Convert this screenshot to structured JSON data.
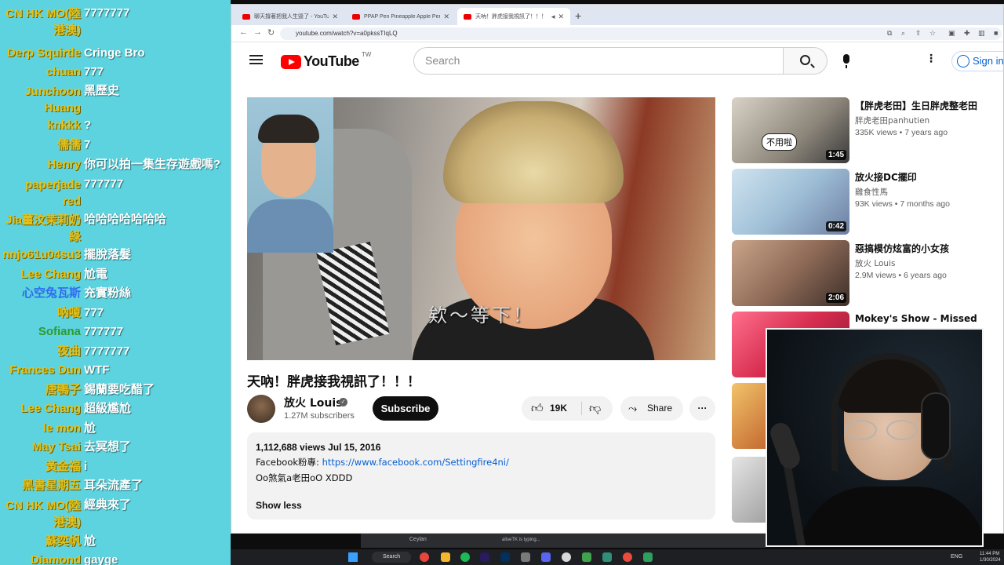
{
  "chat": [
    {
      "user": "CN HK MO(陸港澳)",
      "user_line2": "港澳)",
      "msg": "7777777",
      "style": "gold"
    },
    {
      "user": "Derp Squirtle",
      "msg": "Cringe Bro",
      "style": "gold"
    },
    {
      "user": "chuan",
      "msg": "777",
      "style": "gold"
    },
    {
      "user": "Junchoon Huang",
      "user_line2": "Huang",
      "msg": "黑歷史",
      "style": "gold"
    },
    {
      "user": "knkkk",
      "msg": "?",
      "style": "gold"
    },
    {
      "user": "儒儒",
      "msg": "7",
      "style": "gold"
    },
    {
      "user": "Henry",
      "msg": "你可以拍一集生存遊戲嗎?",
      "style": "gold"
    },
    {
      "user": "paperjade red",
      "user_line2": "red",
      "msg": "777777",
      "style": "gold"
    },
    {
      "user": "Jia薑汶茉莉奶綠",
      "user_line2": "綠",
      "msg": "哈哈哈哈哈哈哈",
      "style": "gold"
    },
    {
      "user": "nnjo61u04su3",
      "msg": "擺脫落髮",
      "style": "gold"
    },
    {
      "user": "Lee Chang",
      "msg": "尬電",
      "style": "gold"
    },
    {
      "user": "心空兔瓦斯",
      "msg": "充實粉絲",
      "style": "blue"
    },
    {
      "user": "吶嗄",
      "msg": "777",
      "style": "gold"
    },
    {
      "user": "Sofiana",
      "msg": "777777",
      "style": "green"
    },
    {
      "user": "夜曲",
      "msg": "7777777",
      "style": "gold"
    },
    {
      "user": "Frances Dun",
      "msg": "WTF",
      "style": "gold"
    },
    {
      "user": "唐鴨子",
      "msg": "錫蘭要吃醋了",
      "style": "gold"
    },
    {
      "user": "Lee Chang",
      "msg": "超級尷尬",
      "style": "gold"
    },
    {
      "user": "le mon",
      "msg": "尬",
      "style": "gold"
    },
    {
      "user": "May Tsai",
      "msg": "去冥想了",
      "style": "gold"
    },
    {
      "user": "黃金福",
      "msg": "i",
      "style": "gold"
    },
    {
      "user": "黑書星期五",
      "msg": "耳朵流產了",
      "style": "gold"
    },
    {
      "user": "CN HK MO(陸港澳)",
      "user_line2": "港澳)",
      "msg": "經典來了",
      "style": "gold"
    },
    {
      "user": "蘇奕帆",
      "msg": "尬",
      "style": "gold"
    },
    {
      "user": "Diamond",
      "msg": "gayge",
      "style": "gold"
    }
  ],
  "browser": {
    "tabs": [
      {
        "label": "聊天撐著把我人生毀了 - YouTube"
      },
      {
        "label": "PPAP Pen Pineapple Apple Pen"
      },
      {
        "label": "天吶！胖虎接我視訊了！！！"
      }
    ],
    "url": "youtube.com/watch?v=a0pkssTIqLQ"
  },
  "youtube": {
    "logo_text": "YouTube",
    "region": "TW",
    "search_placeholder": "Search",
    "signin": "Sign in",
    "video": {
      "subtitle": "欸～等下！",
      "title": "天吶！胖虎接我視訊了！！！",
      "channel": "放火 Louis",
      "subs": "1.27M subscribers",
      "subscribe": "Subscribe",
      "likes": "19K",
      "share": "Share",
      "more": "···",
      "stats": "1,112,688 views  Jul 15, 2016",
      "desc_prefix": "Facebook粉專: ",
      "desc_link": "https://www.facebook.com/Settingfire4ni/",
      "desc_line2": "Oo煞氣a老田oO XDDD",
      "show_less": "Show less"
    },
    "recs": [
      {
        "title": "【胖虎老田】生日胖虎整老田",
        "channel": "胖虎老田panhutien",
        "meta": "335K views • 7 years ago",
        "duration": "1:45",
        "sticker": "不用啦"
      },
      {
        "title": "放火接DC擺印",
        "channel": "雞食性馬",
        "meta": "93K views • 7 months ago",
        "duration": "0:42"
      },
      {
        "title": "惡搞模仿炫富的小女孩",
        "channel": "放火 Louis",
        "meta": "2.9M views • 6 years ago",
        "duration": "2:06"
      },
      {
        "title": "Mokey's Show - Missed",
        "channel": "",
        "meta": "",
        "duration": ""
      },
      {
        "title": "",
        "channel": "",
        "meta": "",
        "duration": ""
      },
      {
        "title": "",
        "channel": "",
        "meta": "",
        "duration": ""
      }
    ]
  },
  "discord": {
    "user": "Ceylan",
    "typing": "aliseTK is typing..."
  },
  "taskbar": {
    "search": "Search",
    "lang": "ENG",
    "time": "11:44 PM",
    "date": "1/30/2024"
  },
  "colors": {
    "chat_bg": "#5cd3de",
    "chat_user": "#e3c21d",
    "yt_red": "#ff0000",
    "link": "#065fd4"
  }
}
